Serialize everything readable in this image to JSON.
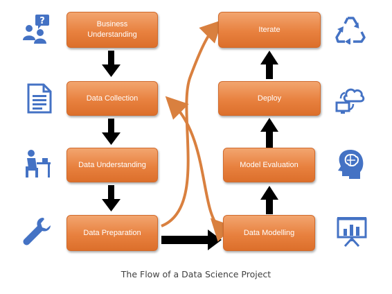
{
  "steps": {
    "business_understanding": "Business Understanding",
    "data_collection": "Data Collection",
    "data_understanding": "Data Understanding",
    "data_preparation": "Data Preparation",
    "data_modelling": "Data Modelling",
    "model_evaluation": "Model Evaluation",
    "deploy": "Deploy",
    "iterate": "Iterate"
  },
  "caption": "The Flow of a Data Science Project",
  "icons": {
    "left": [
      "people-question-icon",
      "document-icon",
      "person-at-desk-icon",
      "wrench-icon"
    ],
    "right": [
      "recycle-icon",
      "cloud-sync-icon",
      "head-brain-icon",
      "presentation-chart-icon"
    ]
  },
  "colors": {
    "box": "#e8813f",
    "arrow_black": "#000000",
    "arrow_orange": "#d9803f",
    "icon_blue": "#4472c4"
  }
}
